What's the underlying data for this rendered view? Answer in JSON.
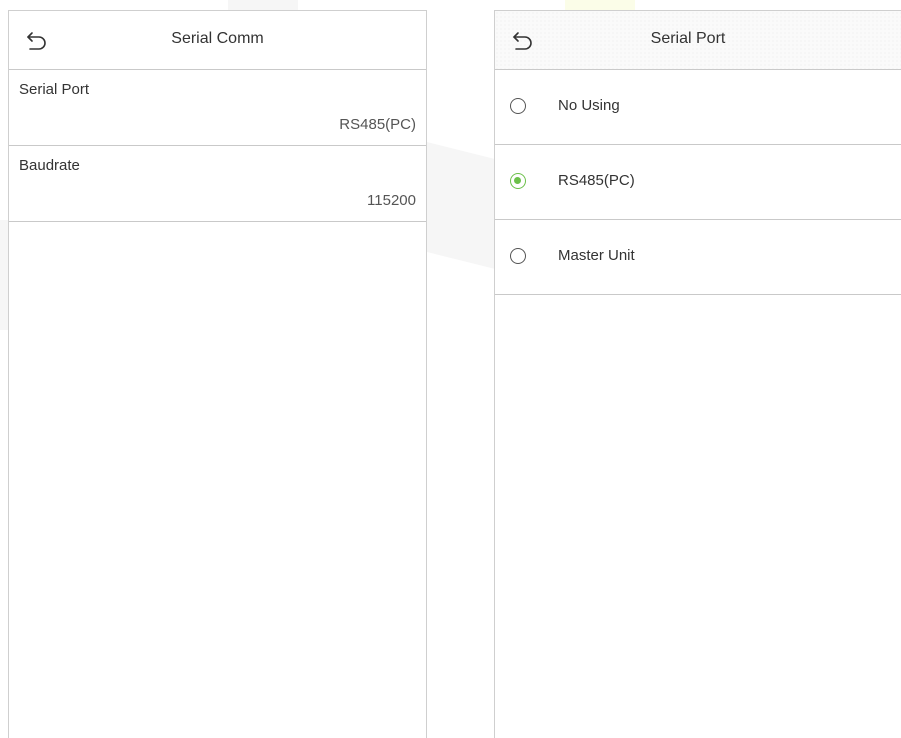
{
  "left_panel": {
    "title": "Serial Comm",
    "back_icon": "back-arrow-icon",
    "settings": [
      {
        "label": "Serial Port",
        "value": "RS485(PC)"
      },
      {
        "label": "Baudrate",
        "value": "115200"
      }
    ]
  },
  "right_panel": {
    "title": "Serial Port",
    "back_icon": "back-arrow-icon",
    "options": [
      {
        "label": "No Using",
        "selected": false
      },
      {
        "label": "RS485(PC)",
        "selected": true
      },
      {
        "label": "Master Unit",
        "selected": false
      }
    ]
  },
  "colors": {
    "accent": "#6cc04a",
    "divider": "#c9c9c9",
    "text": "#333333"
  }
}
